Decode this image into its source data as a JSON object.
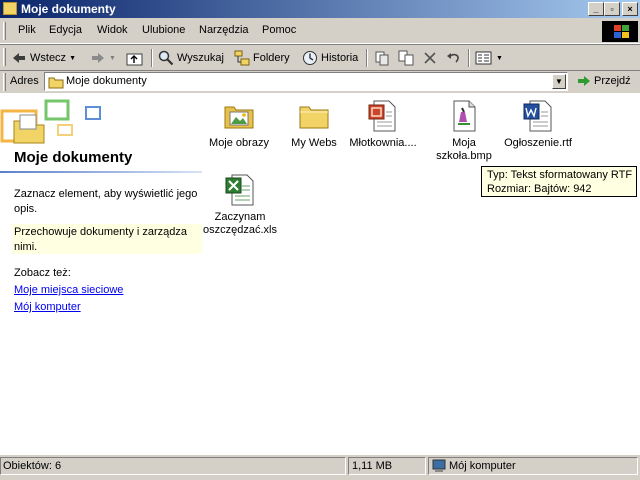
{
  "window": {
    "title": "Moje dokumenty"
  },
  "menu": [
    "Plik",
    "Edycja",
    "Widok",
    "Ulubione",
    "Narzędzia",
    "Pomoc"
  ],
  "toolbar": {
    "back": "Wstecz",
    "search": "Wyszukaj",
    "folders": "Foldery",
    "history": "Historia"
  },
  "address": {
    "label": "Adres",
    "value": "Moje dokumenty",
    "go": "Przejdź"
  },
  "panel": {
    "title": "Moje dokumenty",
    "description": "Zaznacz element, aby wyświetlić jego opis.",
    "hint": "Przechowuje dokumenty i zarządza nimi.",
    "see_also": "Zobacz też:",
    "links": [
      "Moje miejsca sieciowe",
      "Mój komputer"
    ]
  },
  "files": [
    {
      "name": "Moje obrazy",
      "icon": "folder-pictures-icon"
    },
    {
      "name": "My Webs",
      "icon": "folder-icon"
    },
    {
      "name": "Młotkownia....",
      "icon": "powerpoint-file-icon"
    },
    {
      "name": "Moja szkoła.bmp",
      "icon": "bitmap-file-icon"
    },
    {
      "name": "Ogłoszenie.rtf",
      "icon": "word-file-icon"
    },
    {
      "name": "Zaczynam oszczędzać.xls",
      "icon": "excel-file-icon"
    }
  ],
  "tooltip": {
    "type_line": "Typ: Tekst sformatowany RTF",
    "size_line": "Rozmiar: Bajtów: 942"
  },
  "status": {
    "objects": "Obiektów: 6",
    "size": "1,11 MB",
    "zone": "Mój komputer"
  }
}
